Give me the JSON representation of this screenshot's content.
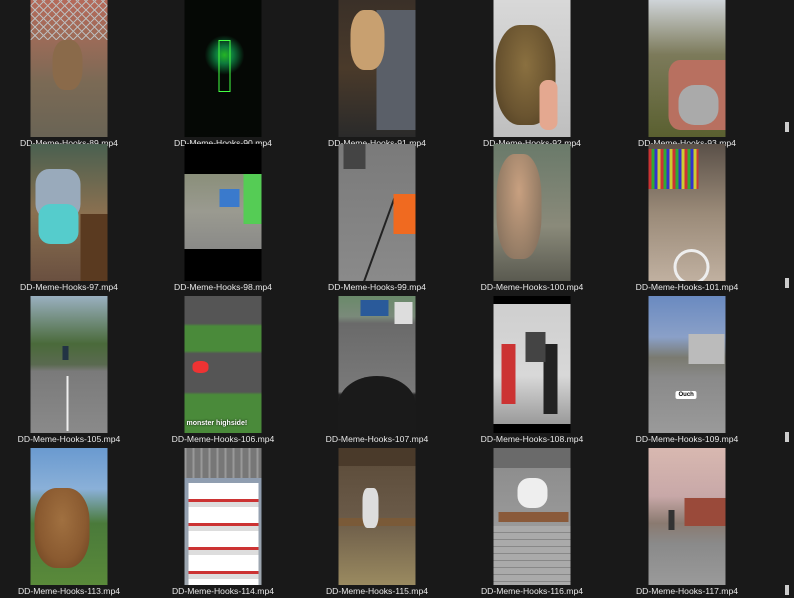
{
  "files": [
    {
      "name": "DD-Meme-Hooks-89.mp4"
    },
    {
      "name": "DD-Meme-Hooks-90.mp4"
    },
    {
      "name": "DD-Meme-Hooks-91.mp4"
    },
    {
      "name": "DD-Meme-Hooks-92.mp4"
    },
    {
      "name": "DD-Meme-Hooks-93.mp4"
    },
    {
      "name": "DD-Meme-Hooks-97.mp4"
    },
    {
      "name": "DD-Meme-Hooks-98.mp4"
    },
    {
      "name": "DD-Meme-Hooks-99.mp4"
    },
    {
      "name": "DD-Meme-Hooks-100.mp4"
    },
    {
      "name": "DD-Meme-Hooks-101.mp4"
    },
    {
      "name": "DD-Meme-Hooks-105.mp4"
    },
    {
      "name": "DD-Meme-Hooks-106.mp4",
      "overlay": "monster highside!"
    },
    {
      "name": "DD-Meme-Hooks-107.mp4"
    },
    {
      "name": "DD-Meme-Hooks-108.mp4"
    },
    {
      "name": "DD-Meme-Hooks-109.mp4",
      "overlay": "Ouch"
    },
    {
      "name": "DD-Meme-Hooks-113.mp4"
    },
    {
      "name": "DD-Meme-Hooks-114.mp4"
    },
    {
      "name": "DD-Meme-Hooks-115.mp4"
    },
    {
      "name": "DD-Meme-Hooks-116.mp4"
    },
    {
      "name": "DD-Meme-Hooks-117.mp4"
    }
  ],
  "colors": {
    "background": "#191919",
    "label_text": "#e8e8e8"
  },
  "icons": [
    "video-thumbnail"
  ]
}
